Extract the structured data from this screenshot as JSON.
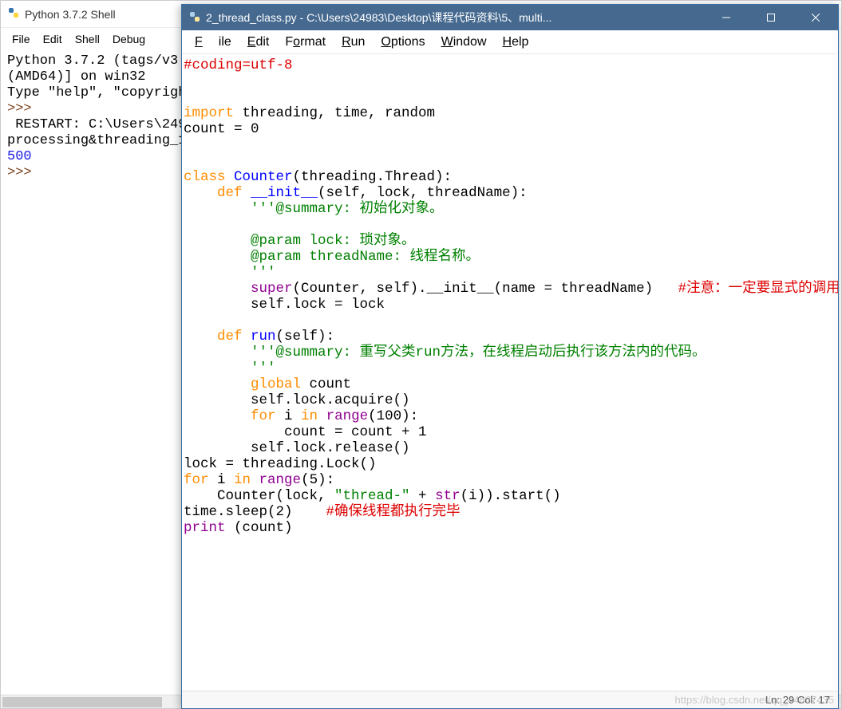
{
  "shell": {
    "title": "Python 3.7.2 Shell",
    "menu": {
      "file": "File",
      "edit": "Edit",
      "shell": "Shell",
      "debug": "Debug"
    },
    "lines": {
      "l1": "Python 3.7.2 (tags/v3.",
      "l2": "(AMD64)] on win32",
      "l3": "Type \"help\", \"copyrigh",
      "l4": ">>> ",
      "l5": " RESTART: C:\\Users\\249",
      "l6": "processing&threading_1",
      "l7": "500",
      "l8": ">>> "
    }
  },
  "editor": {
    "title": "2_thread_class.py - C:\\Users\\24983\\Desktop\\课程代码资料\\5、multi...",
    "menu": {
      "file": "File",
      "edit": "Edit",
      "format": "Format",
      "run": "Run",
      "options": "Options",
      "window": "Window",
      "help": "Help"
    },
    "status": "Ln: 29  Col: 17",
    "code": {
      "l1": "#coding=utf-8",
      "l2": "",
      "l3": "",
      "l4_kw": "import",
      "l4_rest": " threading, time, random",
      "l5": "count = 0",
      "l6": "",
      "l7": "",
      "l8_kw": "class",
      "l8_name": " Counter",
      "l8_rest": "(threading.Thread):",
      "l9_indent": "    ",
      "l9_kw": "def",
      "l9_name": " __init__",
      "l9_rest": "(self, lock, threadName):",
      "l10": "        '''@summary: 初始化对象。",
      "l11": "",
      "l12": "        @param lock: 琐对象。",
      "l13": "        @param threadName: 线程名称。",
      "l14": "        '''",
      "l15_indent": "        ",
      "l15_super": "super",
      "l15_mid": "(Counter, self).__init__(name = threadName)   ",
      "l15_cmt": "#注意：一定要显式的调用",
      "l16": "        self.lock = lock",
      "l17": "",
      "l18_indent": "    ",
      "l18_kw": "def",
      "l18_name": " run",
      "l18_rest": "(self):",
      "l19": "        '''@summary: 重写父类run方法，在线程启动后执行该方法内的代码。",
      "l20": "        '''",
      "l21_indent": "        ",
      "l21_kw": "global",
      "l21_rest": " count",
      "l22": "        self.lock.acquire()",
      "l23_indent": "        ",
      "l23_for": "for",
      "l23_i": " i ",
      "l23_in": "in",
      "l23_range": " range",
      "l23_rest": "(100):",
      "l24": "            count = count + 1",
      "l25": "        self.lock.release()",
      "l26": "lock = threading.Lock()",
      "l27_for": "for",
      "l27_i": " i ",
      "l27_in": "in",
      "l27_range": " range",
      "l27_rest": "(5):",
      "l28_indent": "    Counter(lock, ",
      "l28_str": "\"thread-\"",
      "l28_mid": " + ",
      "l28_strfn": "str",
      "l28_rest": "(i)).start()",
      "l29_a": "time.sleep(2)    ",
      "l29_cmt": "#确保线程都执行完毕",
      "l30_print": "print",
      "l30_rest": " (count)"
    }
  },
  "watermark": "https://blog.csdn.net/qq_44867435"
}
